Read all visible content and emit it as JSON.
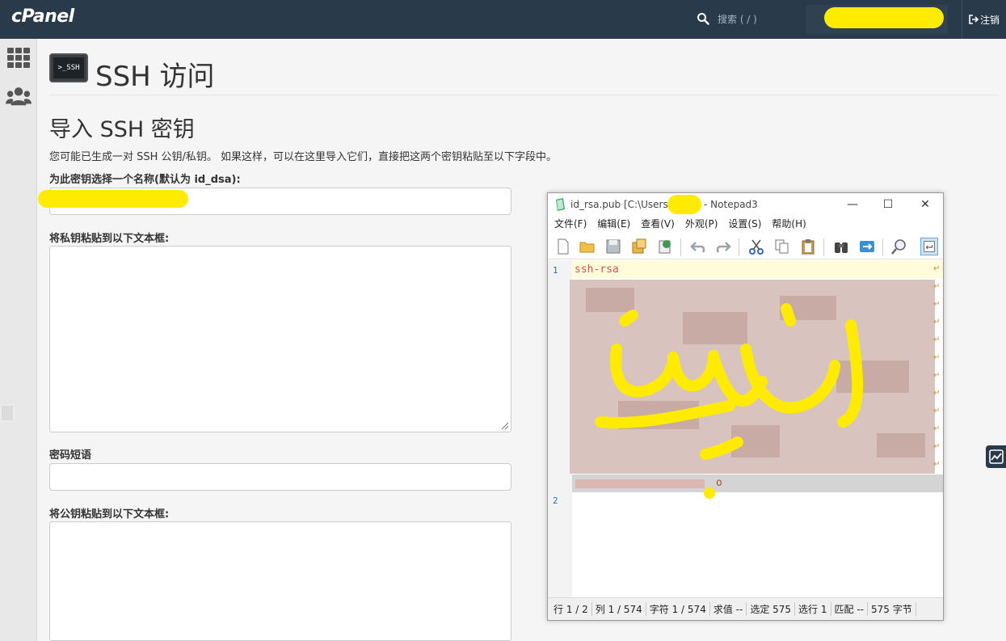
{
  "header": {
    "logo": "cPanel",
    "search_placeholder": "搜索 ( / )",
    "logout_label": "注销"
  },
  "page": {
    "icon_label": ">_SSH",
    "title": "SSH 访问"
  },
  "import": {
    "section_title": "导入 SSH 密钥",
    "description": "您可能已生成一对 SSH 公钥/私钥。 如果这样，可以在这里导入它们，直接把这两个密钥粘贴至以下字段中。",
    "name_label": "为此密钥选择一个名称(默认为 id_dsa):",
    "private_key_label": "将私钥粘贴到以下文本框:",
    "passphrase_label": "密码短语",
    "public_key_label": "将公钥粘贴到以下文本框:"
  },
  "notepad": {
    "title": "id_rsa.pub [C:\\Users\\      \\.ssh] - Notepad3",
    "menu": [
      "文件(F)",
      "编辑(E)",
      "查看(V)",
      "外观(P)",
      "设置(S)",
      "帮助(H)"
    ],
    "line_numbers": [
      "1",
      "2"
    ],
    "code_line1": "ssh-rsa",
    "code_last_char": "o",
    "status": [
      "行  1 / 2",
      "列  1 / 574",
      "字符  1 / 574",
      "求值  --",
      "选定  575",
      "选行  1",
      "匹配  --",
      "575 字节"
    ]
  },
  "colors": {
    "topbar": "#293a4a",
    "highlight_scribble": "#ffeb00",
    "sidebar": "#e8e8e8"
  }
}
